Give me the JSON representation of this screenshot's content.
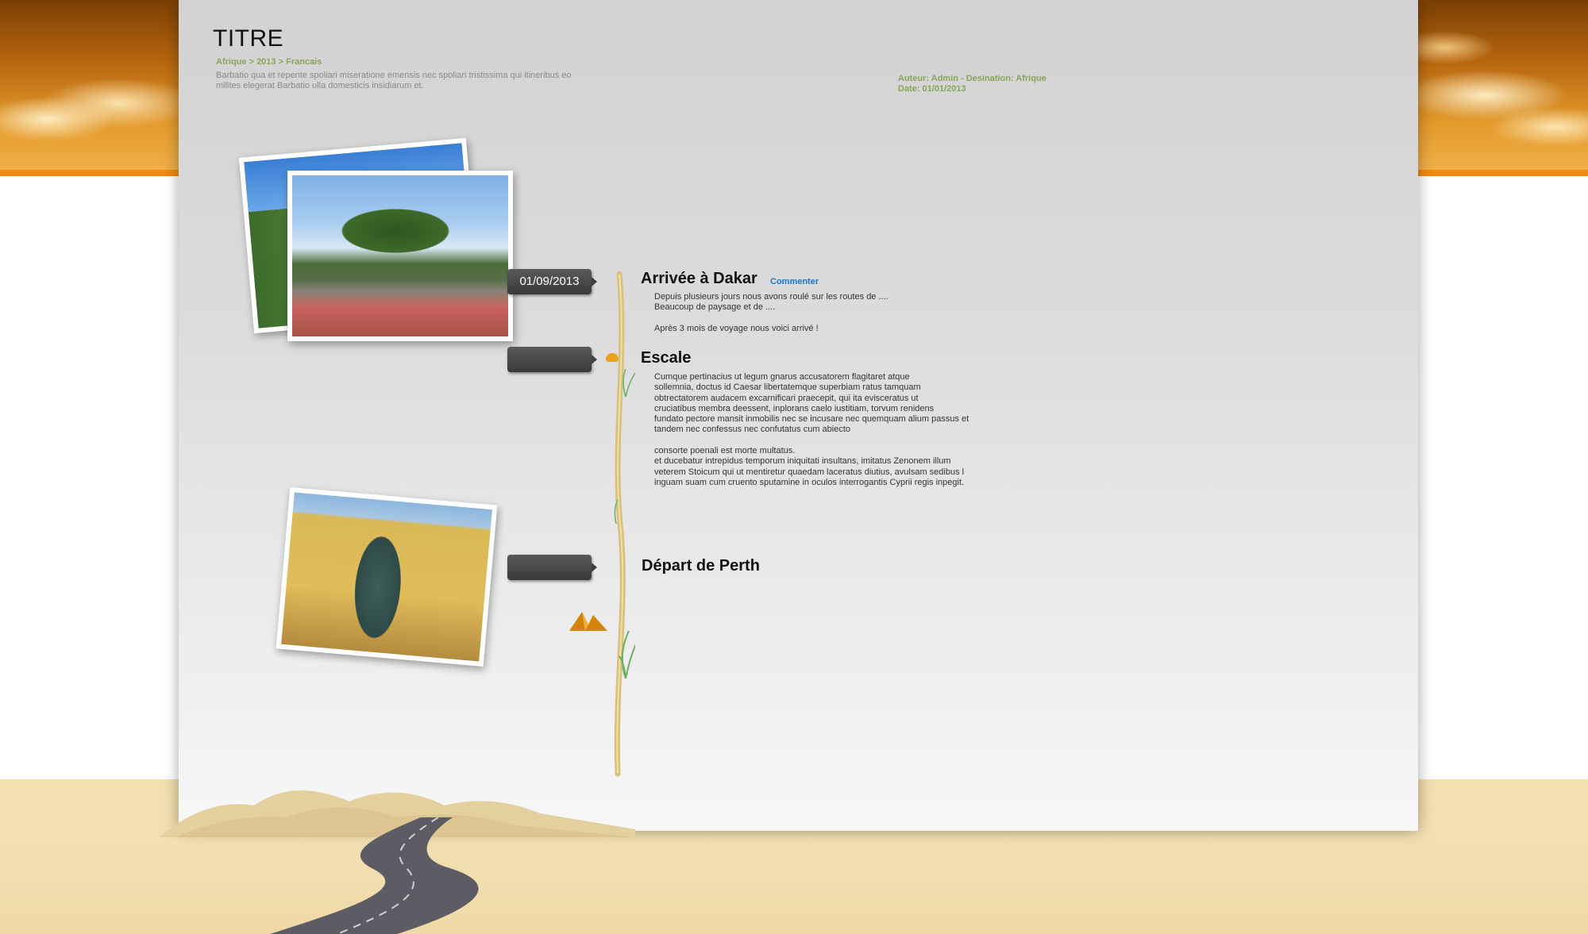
{
  "header": {
    "title": "TITRE",
    "breadcrumb": [
      "Afrique",
      "2013",
      "Francais"
    ],
    "breadcrumb_separator": ">",
    "intro": "Barbatio qua et repente spoliari miseratione emensis nec spoliari tristissima qui itineribus eo milites elegerat Barbatio ulla domesticis insidiarum et.",
    "meta_line1": "Auteur: Admin - Desination: Afrique",
    "meta_line2": "Date: 01/01/2013"
  },
  "timeline": [
    {
      "date": "01/09/2013",
      "title": "Arrivée à Dakar",
      "comment_label": "Commenter",
      "body": "Depuis plusieurs jours nous avons roulé sur les routes de ....\nBeaucoup de paysage et de ....\n\nAprès 3 mois de voyage nous voici arrivé !"
    },
    {
      "date": "",
      "title": "Escale",
      "body": "Cumque pertinacius ut legum gnarus accusatorem flagitaret atque\nsollemnia, doctus id Caesar libertatemque superbiam ratus tamquam\nobtrectatorem audacem excarnificari praecepit, qui ita evisceratus ut\ncruciatibus membra deessent, inplorans caelo iustitiam, torvum renidens\n fundato pectore mansit inmobilis nec se incusare nec quemquam alium passus et\ntandem nec confessus nec confutatus cum abiecto\n\nconsorte poenali est morte multatus.\net ducebatur intrepidus temporum iniquitati insultans, imitatus Zenonem illum\nveterem Stoicum qui ut mentiretur quaedam laceratus diutius, avulsam sedibus l\ninguam suam cum cruento sputamine in oculos interrogantis Cyprii regis inpegit."
    },
    {
      "date": "",
      "title": "Départ de Perth"
    }
  ],
  "colors": {
    "accent_green": "#86a65a",
    "link_blue": "#1d76c8",
    "sky_orange": "#e39a2c",
    "sand": "#f2e0b2"
  }
}
